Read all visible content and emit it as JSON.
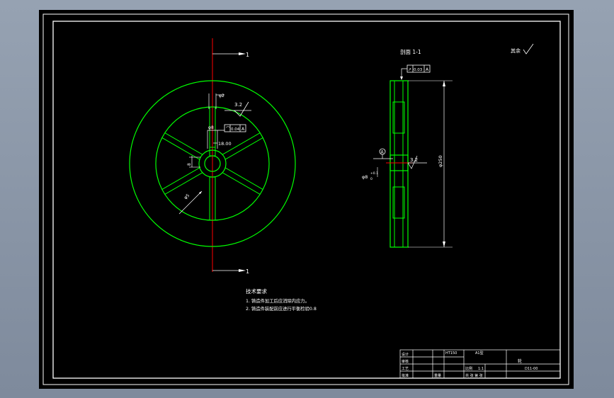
{
  "drawing": {
    "frame_color": "#ffffff",
    "part_color": "#00ff00",
    "centerline_color": "#ff0000",
    "text_color": "#ffffff",
    "front_view": {
      "section_marks": [
        "1",
        "1"
      ],
      "dimensions": [
        "φ2",
        "3.2",
        "φ8",
        "18.00",
        "8",
        "φ5"
      ],
      "flatness_box": [
        "⌒",
        "0.04",
        "A"
      ]
    },
    "section_view": {
      "title": "剖面 1-1",
      "runout_box": [
        "↗",
        "0.03",
        "A"
      ],
      "datum": "A",
      "dimensions": [
        "3.2",
        "φ8",
        "+0.1",
        "0",
        "φ250"
      ]
    },
    "roughness_note": "其余",
    "roughness_value": "√",
    "tech_requirements": {
      "title": "技术要求",
      "items": [
        "1. 铸造件加工后应消除内应力。",
        "2. 铸造件装配前应进行平衡检验0.8"
      ]
    },
    "title_block": {
      "material": "HT150",
      "code": "A1型",
      "row_labels": [
        "设计",
        "审核",
        "工艺",
        "批准"
      ],
      "scale_label": "比例",
      "scale_value": "1:1",
      "part_name": "轮",
      "drawing_no": "D11-00",
      "sheet_label": "共 张 第 张",
      "weight_label": "重量"
    }
  }
}
